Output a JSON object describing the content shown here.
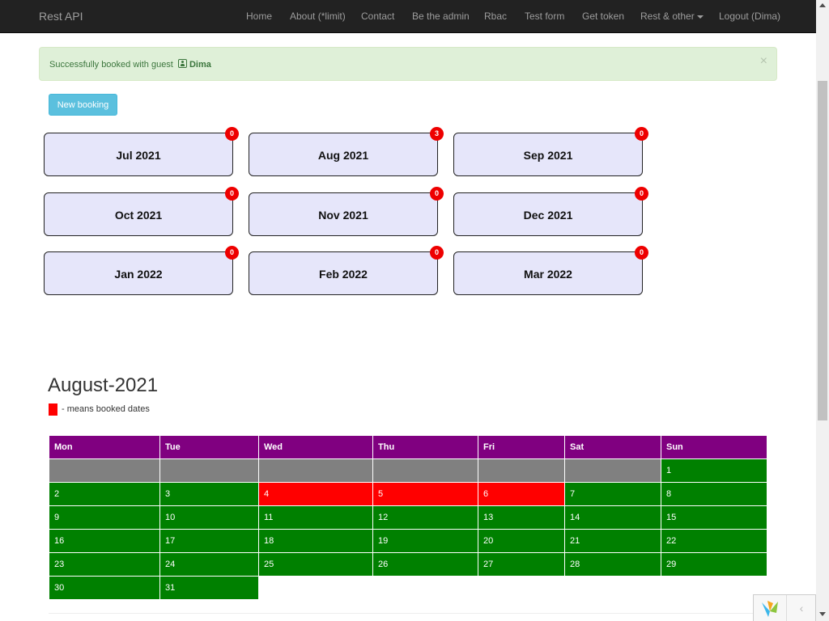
{
  "navbar": {
    "brand": "Rest API",
    "items": [
      {
        "label": "Home"
      },
      {
        "label": "About (*limit)"
      },
      {
        "label": "Contact"
      },
      {
        "label": "Be the admin"
      },
      {
        "label": "Rbac"
      },
      {
        "label": "Test form"
      },
      {
        "label": "Get token"
      },
      {
        "label": "Rest & other"
      },
      {
        "label": "Logout (Dima)"
      }
    ]
  },
  "alert": {
    "text": "Successfully booked with guest",
    "guest": "Dima",
    "close": "×"
  },
  "new_booking_label": "New booking",
  "months": [
    {
      "label": "Jul 2021",
      "count": "0"
    },
    {
      "label": "Aug 2021",
      "count": "3"
    },
    {
      "label": "Sep 2021",
      "count": "0"
    },
    {
      "label": "Oct 2021",
      "count": "0"
    },
    {
      "label": "Nov 2021",
      "count": "0"
    },
    {
      "label": "Dec 2021",
      "count": "0"
    },
    {
      "label": "Jan 2022",
      "count": "0"
    },
    {
      "label": "Feb 2022",
      "count": "0"
    },
    {
      "label": "Mar 2022",
      "count": "0"
    }
  ],
  "calendar": {
    "title": "August-2021",
    "legend": "- means booked dates",
    "weekdays": [
      "Mon",
      "Tue",
      "Wed",
      "Thu",
      "Fri",
      "Sat",
      "Sun"
    ],
    "weeks": [
      [
        {
          "day": "",
          "status": "pad"
        },
        {
          "day": "",
          "status": "pad"
        },
        {
          "day": "",
          "status": "pad"
        },
        {
          "day": "",
          "status": "pad"
        },
        {
          "day": "",
          "status": "pad"
        },
        {
          "day": "",
          "status": "pad"
        },
        {
          "day": "1",
          "status": "free"
        }
      ],
      [
        {
          "day": "2",
          "status": "free"
        },
        {
          "day": "3",
          "status": "free"
        },
        {
          "day": "4",
          "status": "booked"
        },
        {
          "day": "5",
          "status": "booked"
        },
        {
          "day": "6",
          "status": "booked"
        },
        {
          "day": "7",
          "status": "free"
        },
        {
          "day": "8",
          "status": "free"
        }
      ],
      [
        {
          "day": "9",
          "status": "free"
        },
        {
          "day": "10",
          "status": "free"
        },
        {
          "day": "11",
          "status": "free"
        },
        {
          "day": "12",
          "status": "free"
        },
        {
          "day": "13",
          "status": "free"
        },
        {
          "day": "14",
          "status": "free"
        },
        {
          "day": "15",
          "status": "free"
        }
      ],
      [
        {
          "day": "16",
          "status": "free"
        },
        {
          "day": "17",
          "status": "free"
        },
        {
          "day": "18",
          "status": "free"
        },
        {
          "day": "19",
          "status": "free"
        },
        {
          "day": "20",
          "status": "free"
        },
        {
          "day": "21",
          "status": "free"
        },
        {
          "day": "22",
          "status": "free"
        }
      ],
      [
        {
          "day": "23",
          "status": "free"
        },
        {
          "day": "24",
          "status": "free"
        },
        {
          "day": "25",
          "status": "free"
        },
        {
          "day": "26",
          "status": "free"
        },
        {
          "day": "27",
          "status": "free"
        },
        {
          "day": "28",
          "status": "free"
        },
        {
          "day": "29",
          "status": "free"
        }
      ],
      [
        {
          "day": "30",
          "status": "free"
        },
        {
          "day": "31",
          "status": "free"
        },
        {
          "day": "",
          "status": "none"
        },
        {
          "day": "",
          "status": "none"
        },
        {
          "day": "",
          "status": "none"
        },
        {
          "day": "",
          "status": "none"
        },
        {
          "day": "",
          "status": "none"
        }
      ]
    ]
  },
  "colors": {
    "navbar_bg": "#222222",
    "alert_bg": "#dff0d8",
    "header_purple": "#800080",
    "free_green": "#008000",
    "booked_red": "#ff0000",
    "padding_gray": "#808080",
    "month_box_bg": "#e6e6fa",
    "button_info": "#5bc0de"
  },
  "icons": {
    "alert_user": "user-icon",
    "dropdown": "caret-down-icon",
    "debug_logo": "yii-logo-icon",
    "debug_toggle": "chevron-left-icon"
  },
  "debug_toggle_glyph": "‹"
}
